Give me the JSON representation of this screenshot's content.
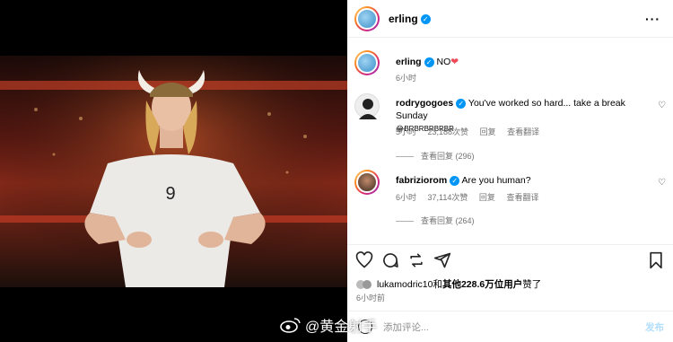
{
  "header": {
    "username": "erling",
    "more_icon": "more-horizontal-icon"
  },
  "caption": {
    "username": "erling",
    "text": "NO",
    "emoji": "❤",
    "time": "6小时"
  },
  "comments": [
    {
      "username": "rodrygogoes",
      "text": "You've worked so hard... take a break Sunday",
      "text2": "😂BRBRBRBRBR",
      "time": "5小时",
      "likes": "23,188次赞",
      "reply": "回复",
      "translate": "查看翻译",
      "view_replies": "查看回复 (296)"
    },
    {
      "username": "fabriziorom",
      "text": "Are you human?",
      "time": "6小时",
      "likes": "37,114次赞",
      "reply": "回复",
      "translate": "查看翻译",
      "view_replies": "查看回复 (264)"
    }
  ],
  "likes_line": {
    "prefix": "lukamodric10和",
    "bold": "其他228.6万位用户",
    "suffix": "赞了"
  },
  "post_time": "6小时前",
  "comment_box": {
    "placeholder": "添加评论...",
    "post": "发布"
  },
  "watermark": {
    "text": "@黄金射手"
  },
  "colors": {
    "verified": "#0095f6",
    "heart": "#ed4956",
    "muted": "#737373"
  }
}
